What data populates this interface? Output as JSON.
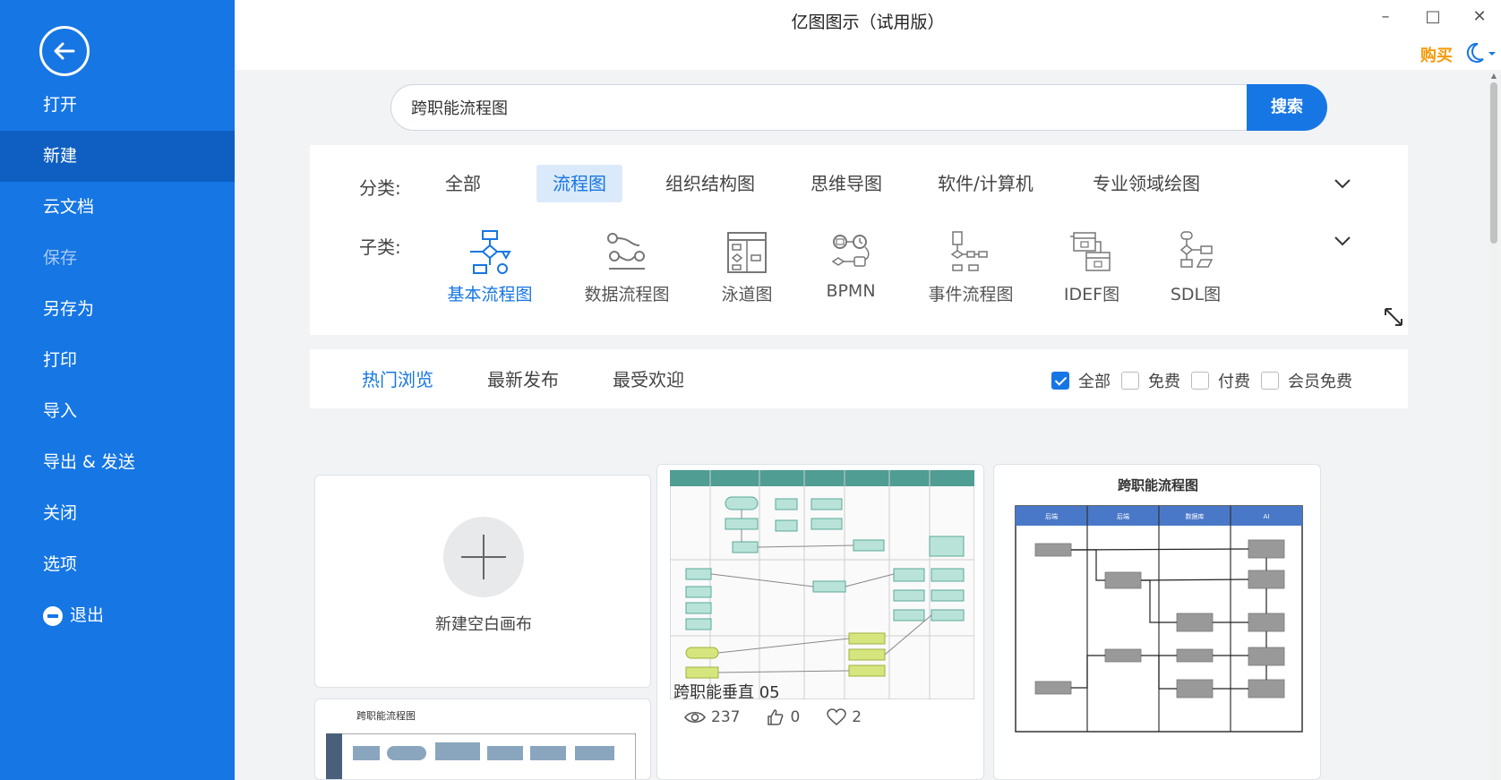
{
  "window": {
    "title": "亿图图示（试用版）",
    "minimize": "–",
    "maximize": "□",
    "close": "✕",
    "buy": "购买"
  },
  "sidebar": {
    "items": [
      {
        "label": "打开",
        "state": "normal"
      },
      {
        "label": "新建",
        "state": "active"
      },
      {
        "label": "云文档",
        "state": "normal"
      },
      {
        "label": "保存",
        "state": "disabled"
      },
      {
        "label": "另存为",
        "state": "normal"
      },
      {
        "label": "打印",
        "state": "normal"
      },
      {
        "label": "导入",
        "state": "normal"
      },
      {
        "label": "导出 & 发送",
        "state": "normal"
      },
      {
        "label": "关闭",
        "state": "normal"
      },
      {
        "label": "选项",
        "state": "normal"
      },
      {
        "label": "退出",
        "state": "normal"
      }
    ]
  },
  "search": {
    "value": "跨职能流程图",
    "button": "搜索"
  },
  "category": {
    "label": "分类:",
    "tabs": [
      "全部",
      "流程图",
      "组织结构图",
      "思维导图",
      "软件/计算机",
      "专业领域绘图"
    ],
    "active_tab": "流程图"
  },
  "subcategory": {
    "label": "子类:",
    "items": [
      "基本流程图",
      "数据流程图",
      "泳道图",
      "BPMN",
      "事件流程图",
      "IDEF图",
      "SDL图"
    ],
    "active_item": "基本流程图"
  },
  "sort_tabs": [
    "热门浏览",
    "最新发布",
    "最受欢迎"
  ],
  "filters": [
    {
      "label": "全部",
      "checked": true
    },
    {
      "label": "免费",
      "checked": false
    },
    {
      "label": "付费",
      "checked": false
    },
    {
      "label": "会员免费",
      "checked": false
    }
  ],
  "blank_card": {
    "label": "新建空白画布"
  },
  "templates": [
    {
      "title": "跨职能垂直 05",
      "views": "237",
      "likes": "0",
      "favorites": "2"
    },
    {
      "title": "跨职能流程图",
      "lanes": [
        "后端",
        "后端",
        "数据库",
        "AI"
      ]
    },
    {
      "title": "跨职能流程图"
    }
  ],
  "colors": {
    "accent": "#1676e4",
    "sidebar": "#1676e4",
    "sidebar_active": "#0f5fc2",
    "buy": "#f59a0a"
  }
}
